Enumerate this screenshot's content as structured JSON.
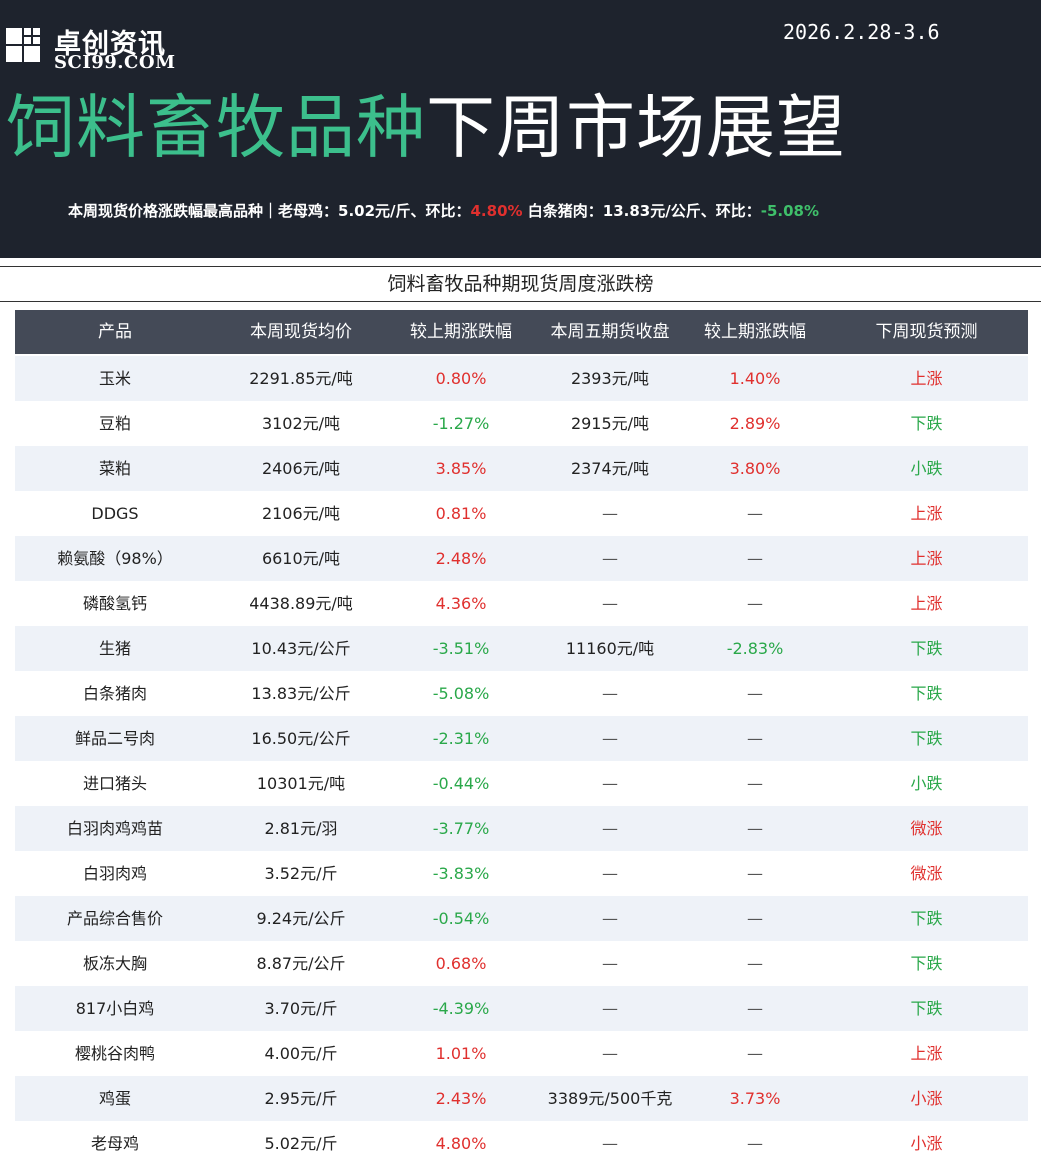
{
  "header": {
    "logo_cn": "卓创资讯",
    "logo_en": "SCI99.COM",
    "date_range": "2026.2.28-3.6",
    "title_green": "饲料畜牧品种",
    "title_white": "下周市场展望",
    "summary_prefix": "本周现货价格涨跌幅最高品种｜老母鸡：5.02元/斤、环比：",
    "summary_val1": "4.80%",
    "summary_mid": "白条猪肉：13.83元/公斤、环比：",
    "summary_val2": "-5.08%"
  },
  "board_title": "饲料畜牧品种期现货周度涨跌榜",
  "columns": [
    "产品",
    "本周现货均价",
    "较上期涨跌幅",
    "本周五期货收盘",
    "较上期涨跌幅",
    "下周现货预测"
  ],
  "rows": [
    {
      "product": "玉米",
      "spot": "2291.85元/吨",
      "spot_chg": "0.80%",
      "spot_dir": "up",
      "fut": "2393元/吨",
      "fut_chg": "1.40%",
      "fut_dir": "up",
      "forecast": "上涨",
      "fc_dir": "up"
    },
    {
      "product": "豆粕",
      "spot": "3102元/吨",
      "spot_chg": "-1.27%",
      "spot_dir": "down",
      "fut": "2915元/吨",
      "fut_chg": "2.89%",
      "fut_dir": "up",
      "forecast": "下跌",
      "fc_dir": "down"
    },
    {
      "product": "菜粕",
      "spot": "2406元/吨",
      "spot_chg": "3.85%",
      "spot_dir": "up",
      "fut": "2374元/吨",
      "fut_chg": "3.80%",
      "fut_dir": "up",
      "forecast": "小跌",
      "fc_dir": "down"
    },
    {
      "product": "DDGS",
      "spot": "2106元/吨",
      "spot_chg": "0.81%",
      "spot_dir": "up",
      "fut": "—",
      "fut_chg": "—",
      "fut_dir": "none",
      "forecast": "上涨",
      "fc_dir": "up"
    },
    {
      "product": "赖氨酸（98%）",
      "spot": "6610元/吨",
      "spot_chg": "2.48%",
      "spot_dir": "up",
      "fut": "—",
      "fut_chg": "—",
      "fut_dir": "none",
      "forecast": "上涨",
      "fc_dir": "up"
    },
    {
      "product": "磷酸氢钙",
      "spot": "4438.89元/吨",
      "spot_chg": "4.36%",
      "spot_dir": "up",
      "fut": "—",
      "fut_chg": "—",
      "fut_dir": "none",
      "forecast": "上涨",
      "fc_dir": "up"
    },
    {
      "product": "生猪",
      "spot": "10.43元/公斤",
      "spot_chg": "-3.51%",
      "spot_dir": "down",
      "fut": "11160元/吨",
      "fut_chg": "-2.83%",
      "fut_dir": "down",
      "forecast": "下跌",
      "fc_dir": "down"
    },
    {
      "product": "白条猪肉",
      "spot": "13.83元/公斤",
      "spot_chg": "-5.08%",
      "spot_dir": "down",
      "fut": "—",
      "fut_chg": "—",
      "fut_dir": "none",
      "forecast": "下跌",
      "fc_dir": "down"
    },
    {
      "product": "鲜品二号肉",
      "spot": "16.50元/公斤",
      "spot_chg": "-2.31%",
      "spot_dir": "down",
      "fut": "—",
      "fut_chg": "—",
      "fut_dir": "none",
      "forecast": "下跌",
      "fc_dir": "down"
    },
    {
      "product": "进口猪头",
      "spot": "10301元/吨",
      "spot_chg": "-0.44%",
      "spot_dir": "down",
      "fut": "—",
      "fut_chg": "—",
      "fut_dir": "none",
      "forecast": "小跌",
      "fc_dir": "down"
    },
    {
      "product": "白羽肉鸡鸡苗",
      "spot": "2.81元/羽",
      "spot_chg": "-3.77%",
      "spot_dir": "down",
      "fut": "—",
      "fut_chg": "—",
      "fut_dir": "none",
      "forecast": "微涨",
      "fc_dir": "up"
    },
    {
      "product": "白羽肉鸡",
      "spot": "3.52元/斤",
      "spot_chg": "-3.83%",
      "spot_dir": "down",
      "fut": "—",
      "fut_chg": "—",
      "fut_dir": "none",
      "forecast": "微涨",
      "fc_dir": "up"
    },
    {
      "product": "产品综合售价",
      "spot": "9.24元/公斤",
      "spot_chg": "-0.54%",
      "spot_dir": "down",
      "fut": "—",
      "fut_chg": "—",
      "fut_dir": "none",
      "forecast": "下跌",
      "fc_dir": "down"
    },
    {
      "product": "板冻大胸",
      "spot": "8.87元/公斤",
      "spot_chg": "0.68%",
      "spot_dir": "up",
      "fut": "—",
      "fut_chg": "—",
      "fut_dir": "none",
      "forecast": "下跌",
      "fc_dir": "down"
    },
    {
      "product": "817小白鸡",
      "spot": "3.70元/斤",
      "spot_chg": "-4.39%",
      "spot_dir": "down",
      "fut": "—",
      "fut_chg": "—",
      "fut_dir": "none",
      "forecast": "下跌",
      "fc_dir": "down"
    },
    {
      "product": "樱桃谷肉鸭",
      "spot": "4.00元/斤",
      "spot_chg": "1.01%",
      "spot_dir": "up",
      "fut": "—",
      "fut_chg": "—",
      "fut_dir": "none",
      "forecast": "上涨",
      "fc_dir": "up"
    },
    {
      "product": "鸡蛋",
      "spot": "2.95元/斤",
      "spot_chg": "2.43%",
      "spot_dir": "up",
      "fut": "3389元/500千克",
      "fut_chg": "3.73%",
      "fut_dir": "up",
      "forecast": "小涨",
      "fc_dir": "up"
    },
    {
      "product": "老母鸡",
      "spot": "5.02元/斤",
      "spot_chg": "4.80%",
      "spot_dir": "up",
      "fut": "—",
      "fut_chg": "—",
      "fut_dir": "none",
      "forecast": "小涨",
      "fc_dir": "up"
    }
  ],
  "colors": {
    "up": "#e0302e",
    "down": "#2aa84a",
    "title_green": "#3cbf8c",
    "banner_bg": "#1e232d",
    "header_bg": "#444a57"
  }
}
